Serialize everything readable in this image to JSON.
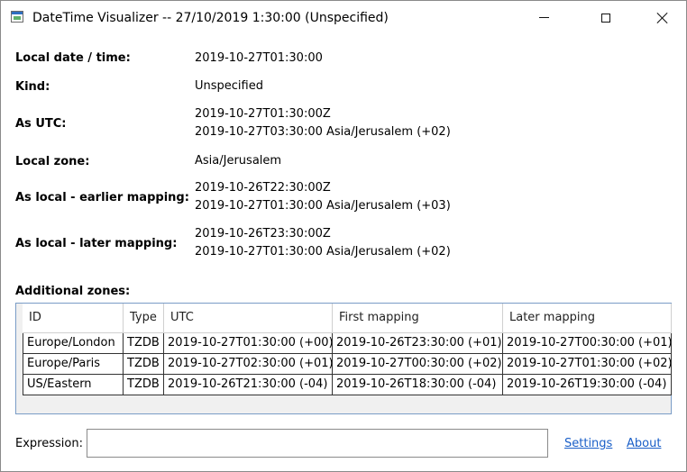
{
  "window": {
    "title": "DateTime Visualizer -- 27/10/2019 1:30:00 (Unspecified)",
    "icon": "datetime-app-icon"
  },
  "properties": [
    {
      "label": "Local date / time:",
      "values": [
        "2019-10-27T01:30:00"
      ]
    },
    {
      "label": "Kind:",
      "values": [
        "Unspecified"
      ]
    },
    {
      "label": "As UTC:",
      "values": [
        "2019-10-27T01:30:00Z",
        "2019-10-27T03:30:00 Asia/Jerusalem (+02)"
      ]
    },
    {
      "label": "Local zone:",
      "values": [
        "Asia/Jerusalem"
      ]
    },
    {
      "label": "As local - earlier mapping:",
      "values": [
        "2019-10-26T22:30:00Z",
        "2019-10-27T01:30:00 Asia/Jerusalem (+03)"
      ]
    },
    {
      "label": "As local - later mapping:",
      "values": [
        "2019-10-26T23:30:00Z",
        "2019-10-27T01:30:00 Asia/Jerusalem (+02)"
      ]
    }
  ],
  "additional_zones": {
    "label": "Additional zones:",
    "columns": [
      "ID",
      "Type",
      "UTC",
      "First mapping",
      "Later mapping"
    ],
    "rows": [
      [
        "Europe/London",
        "TZDB",
        "2019-10-27T01:30:00 (+00)",
        "2019-10-26T23:30:00 (+01)",
        "2019-10-27T00:30:00 (+01)"
      ],
      [
        "Europe/Paris",
        "TZDB",
        "2019-10-27T02:30:00 (+01)",
        "2019-10-27T00:30:00 (+02)",
        "2019-10-27T01:30:00 (+02)"
      ],
      [
        "US/Eastern",
        "TZDB",
        "2019-10-26T21:30:00 (-04)",
        "2019-10-26T18:30:00 (-04)",
        "2019-10-26T19:30:00 (-04)"
      ]
    ]
  },
  "footer": {
    "expression_label": "Expression:",
    "expression_value": "",
    "settings_link": "Settings",
    "about_link": "About"
  }
}
